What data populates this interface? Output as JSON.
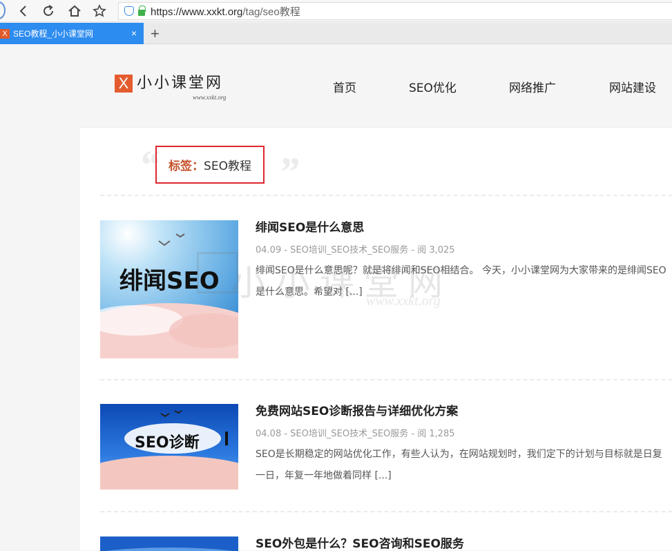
{
  "browser": {
    "url_host": "https://www.xxkt.org",
    "url_path": "/tag/seo教程",
    "tab_title": "SEO教程_小小课堂网",
    "tab_favicon": "X",
    "tab_close": "×",
    "new_tab": "+"
  },
  "site": {
    "logo_mark": "X",
    "logo_text": "小小课堂网",
    "logo_sub": "www.xxkt.org",
    "nav": [
      "首页",
      "SEO优化",
      "网络推广",
      "网站建设"
    ]
  },
  "tag": {
    "label": "标签：",
    "value": "SEO教程",
    "quote_open": "“",
    "quote_close": "”"
  },
  "posts": [
    {
      "title": "绯闻SEO是什么意思",
      "meta": "04.09 - SEO培训_SEO技术_SEO服务 - 阅 3,025",
      "excerpt": "绯闻SEO是什么意思呢？就是将绯闻和SEO相结合。 今天，小小课堂网为大家带来的是绯闻SEO是什么意思。希望对 [...]",
      "thumb_text": "绯闻SEO"
    },
    {
      "title": "免费网站SEO诊断报告与详细优化方案",
      "meta": "04.08 - SEO培训_SEO技术_SEO服务 - 阅 1,285",
      "excerpt": "SEO是长期稳定的网站优化工作，有些人认为，在网站规划时，我们定下的计划与目标就是日复一日，年复一年地做着同样 [...]",
      "thumb_text": "SEO诊断"
    },
    {
      "title": "SEO外包是什么？SEO咨询和SEO服务",
      "meta": "",
      "excerpt": "",
      "thumb_text": ""
    }
  ],
  "watermark": {
    "text": "小小课堂网",
    "sub": "www.xxkt.org"
  },
  "colors": {
    "accent": "#e45c2e",
    "tab_active": "#2d8cf0",
    "highlight_border": "#e0252f"
  }
}
